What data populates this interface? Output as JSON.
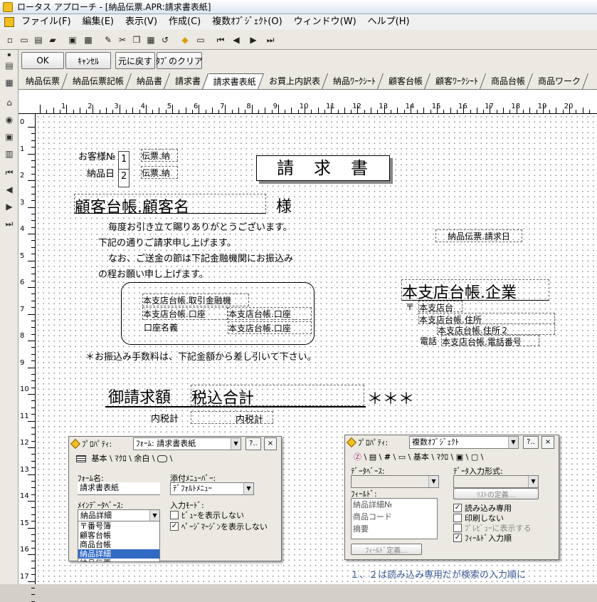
{
  "title": "ロータス アプローチ - [納品伝票.APR:請求書表紙]",
  "menu": [
    "ファイル(F)",
    "編集(E)",
    "表示(V)",
    "作成(C)",
    "複数ｵﾌﾞｼﾞｪｸﾄ(O)",
    "ウィンドウ(W)",
    "ヘルプ(H)"
  ],
  "buttons": {
    "ok": "OK",
    "cancel": "ｷｬﾝｾﾙ",
    "revert": "元に戻す",
    "clear": "ﾀﾌﾞのクリア"
  },
  "tabs": [
    "納品伝票",
    "納品伝票記帳",
    "納品書",
    "請求書",
    "請求書表紙",
    "お買上内訳表",
    "納品ﾜｰｸｼｰﾄ",
    "顧客台帳",
    "顧客ﾜｰｸｼｰﾄ",
    "商品台帳",
    "商品ワーク"
  ],
  "ruler": {
    "h": [
      "1",
      "2",
      "3",
      "4",
      "5",
      "6",
      "7",
      "8",
      "9",
      "10",
      "11",
      "12",
      "13",
      "14",
      "15",
      "16",
      "17",
      "18",
      "19",
      "20"
    ],
    "v": [
      "0",
      "1",
      "2",
      "3",
      "4",
      "5",
      "6",
      "7",
      "8",
      "9",
      "10",
      "11",
      "12",
      "13",
      "14",
      "15",
      "16",
      "17"
    ]
  },
  "form": {
    "customer_no_label": "お客様№",
    "customer_no_field": "伝票.納",
    "delivery_date_label": "納品日",
    "delivery_date_field": "伝票.納",
    "order1": "1",
    "order2": "2",
    "doc_title": "請　求　書",
    "customer_name_field": "顧客台帳.顧客名",
    "honorific": "様",
    "greeting1": "毎度お引き立て賜りありがとうございます。",
    "greeting2": "下記の通りご請求申し上げます。",
    "greeting3": "なお、ご送金の節は下記金融機関にお振込み",
    "greeting4": "の程お願い申し上げます。",
    "invoice_date_field": "納品伝票.請求日",
    "bank_name_field": "本支店台帳.取引金融機",
    "bank_branch_field": "本支店台帳.口座",
    "bank_type_field": "本支店台帳.口座",
    "account_name_label": "口座名義",
    "account_name_field": "本支店台帳.口座",
    "company_field": "本支店台帳.企業",
    "postal_mark": "〒",
    "postal_field": "本支店台",
    "address_field": "本支店台帳.住所",
    "address2_field": "本支店台帳.住所２",
    "phone_label": "電話",
    "phone_field": "本支店台帳.電話番号",
    "fee_note": "＊お振込み手数料は、下記金額から差し引いて下さい。",
    "total_label": "御請求額",
    "total_field": "税込合計",
    "stars": "＊＊＊",
    "tax_label": "内税計",
    "tax_field": "内税計",
    "note": "１、２は読み込み専用だが検索の入力順に"
  },
  "panel1": {
    "title": "ﾌﾟﾛﾊﾟﾃｨ:",
    "selector": "ﾌｫｰﾑ: 請求書表紙",
    "help": "?..",
    "close": "×",
    "tabs": [
      "基本",
      "ﾏｸﾛ",
      "余白"
    ],
    "form_name_label": "ﾌｫｰﾑ名:",
    "form_name_value": "請求書表紙",
    "menu_label": "添付ﾒﾆｭｰﾊﾞｰ:",
    "menu_value": "ﾃﾞﾌｫﾙﾄﾒﾆｭｰ",
    "main_db_label": "ﾒｲﾝﾃﾞｰﾀﾍﾞｰｽ:",
    "main_db_value": "納品詳細",
    "db_list": [
      "〒番号簿",
      "顧客台帳",
      "商品台帳",
      "納品詳細",
      "納品伝票"
    ],
    "db_selected": "納品詳細",
    "input_mode_label": "入力ﾓｰﾄﾞ:",
    "opt1": "ﾋﾞｭｰを表示しない",
    "opt2": "ﾍﾟｰｼﾞﾏｰｼﾞﾝを表示しない"
  },
  "panel2": {
    "title": "ﾌﾟﾛﾊﾟﾃｨ:",
    "selector": "複数ｵﾌﾞｼﾞｪｸﾄ",
    "help": "?..",
    "close": "×",
    "tabs": [
      "基本",
      "ﾏｸﾛ"
    ],
    "db_label": "ﾃﾞｰﾀﾍﾞｰｽ:",
    "input_format_label": "ﾃﾞｰﾀ入力形式:",
    "field_label": "ﾌｨｰﾙﾄﾞ:",
    "fields": [
      "納品詳細№",
      "商品コード",
      "摘要"
    ],
    "list_def": "ﾘｽﾄの定義...",
    "field_def": "ﾌｨｰﾙﾄﾞ定義...",
    "opt_readonly": "読み込み専用",
    "opt_noprint": "印刷しない",
    "opt_preview": "ﾌﾟﾚﾋﾞｭｰに表示する",
    "opt_order": "ﾌｨｰﾙﾄﾞ入力順"
  }
}
